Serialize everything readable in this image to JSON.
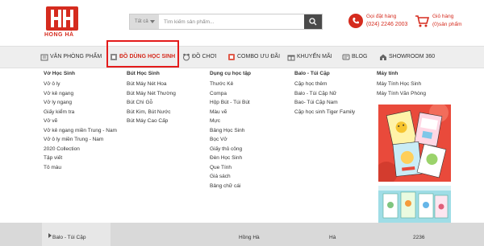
{
  "brand": {
    "logo_text": "HONG HÀ",
    "color": "#d52b1e"
  },
  "search": {
    "category_label": "Tất cả",
    "placeholder": "Tìm kiếm sản phẩm..."
  },
  "hotline": {
    "label": "Gọi đặt hàng",
    "number": "(024) 2246 2003"
  },
  "cart": {
    "label": "Giỏ hàng",
    "count": "(0)sản phẩm"
  },
  "nav": {
    "items": [
      {
        "label": "VĂN PHÒNG PHẨM",
        "icon": "office-supplies-icon"
      },
      {
        "label": "ĐỒ DÙNG HỌC SINH",
        "icon": "school-supplies-icon",
        "active": true
      },
      {
        "label": "ĐỒ CHƠI",
        "icon": "toy-icon"
      },
      {
        "label": "COMBO ƯU ĐÃI",
        "icon": "combo-icon"
      },
      {
        "label": "KHUYẾN MÃI",
        "icon": "gift-icon"
      },
      {
        "label": "BLOG",
        "icon": "blog-icon"
      },
      {
        "label": "SHOWROOM 360",
        "icon": "showroom-icon"
      }
    ]
  },
  "menu": {
    "columns": [
      {
        "heading": "Vở Học Sinh",
        "items": [
          "Vở ô ly",
          "Vở kẻ ngang",
          "Vở ly ngang",
          "Giấy kiểm tra",
          "Vở vẽ",
          "Vở kẻ ngang miền Trung - Nam",
          "Vở ô ly miền Trung - Nam",
          "2020 Collection",
          "Tập viết",
          "Tô màu"
        ]
      },
      {
        "heading": "Bút Học Sinh",
        "items": [
          "Bút Máy Nét Hoa",
          "Bút Máy Nét Thường",
          "Bút Chì Gỗ",
          "Bút Kim, Bút Nước",
          "Bút Máy Cao Cấp"
        ]
      },
      {
        "heading": "Dụng cụ học tập",
        "items": [
          "Thước Kẻ",
          "Compa",
          "Hộp Bút - Túi Bút",
          "Màu vẽ",
          "Mực",
          "Bảng Học Sinh",
          "Bọc Vở",
          "Giấy thủ công",
          "Đèn Học Sinh",
          "Que Tính",
          "Giá sách",
          "Bảng chữ cái"
        ]
      },
      {
        "heading": "Balo - Túi Cặp",
        "items": [
          "Cặp học thêm",
          "Balo - Túi Cặp Nữ",
          "Bao- Túi Cặp Nam",
          "Cặp học sinh Tiger Family"
        ]
      },
      {
        "heading": "Máy tính",
        "items": [
          "Máy Tính Học Sinh",
          "Máy Tính Văn Phòng"
        ]
      }
    ]
  },
  "bottom": {
    "side_label": "Balo - Túi Cặp",
    "texts": [
      "Hồng Hà",
      "Hà",
      "2236"
    ]
  },
  "colors": {
    "accent": "#d52b1e",
    "highlight": "#e41b1b",
    "nav_bg": "#eeeeee"
  }
}
